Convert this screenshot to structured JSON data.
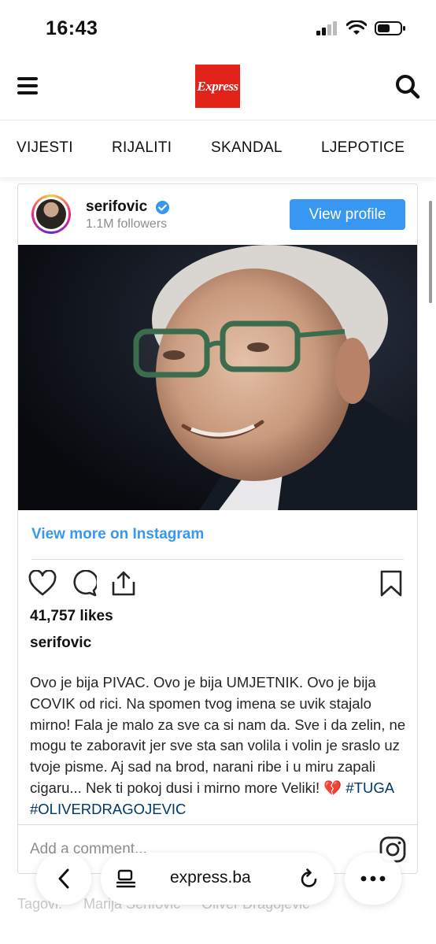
{
  "status": {
    "time": "16:43"
  },
  "header": {
    "logo_text": "Express",
    "brand_color": "#e2231a"
  },
  "nav": {
    "items": [
      "VIJESTI",
      "RIJALITI",
      "SKANDAL",
      "LJEPOTICE"
    ]
  },
  "embed": {
    "username": "serifovic",
    "followers": "1.1M followers",
    "view_profile": "View profile",
    "view_more": "View more on Instagram",
    "likes": "41,757 likes",
    "caption_user": "serifovic",
    "caption_text": "Ovo je bija PIVAC. Ovo je bija UMJETNIK. Ovo je bija COVIK od rici. Na spomen tvog imena se uvik stajalo mirno! Fala je malo za sve ca si nam da. Sve i da zelin, ne mogu te zaboravit jer sve sta san volila i volin je sraslo uz tvoje pisme. Aj sad na brod, narani ribe i u miru zapali cigaru... Nek ti pokoj dusi i mirno more Veliki! ",
    "caption_emoji": "💔",
    "caption_tags": "#TUGA #OLIVERDRAGOJEVIC",
    "comment_placeholder": "Add a comment...",
    "accent_color": "#3897f0"
  },
  "tags_row": {
    "label": "Tagovi:",
    "items": [
      "Marija Šerifović",
      "Oliver Dragojević"
    ]
  },
  "browser": {
    "url": "express.ba"
  }
}
